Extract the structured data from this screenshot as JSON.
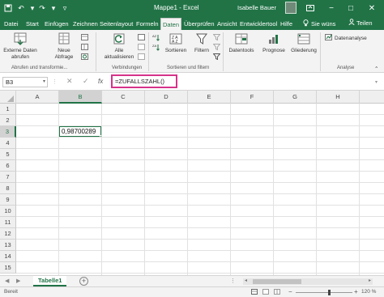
{
  "titlebar": {
    "title": "Mappe1  -  Excel",
    "user": "Isabelle Bauer",
    "minimize": "−",
    "maximize": "□",
    "close": "✕"
  },
  "tabs": [
    "Datei",
    "Start",
    "Einfügen",
    "Zeichnen",
    "Seitenlayout",
    "Formeln",
    "Daten",
    "Überprüfen",
    "Ansicht",
    "Entwicklertool",
    "Hilfe"
  ],
  "active_tab": "Daten",
  "tellme": "Sie wüns",
  "share": "Teilen",
  "ribbon": {
    "external_data": [
      "Externe Daten",
      "abrufen"
    ],
    "new_query": [
      "Neue",
      "Abfrage"
    ],
    "group1_label": "Abrufen und transformie...",
    "refresh_all": [
      "Alle",
      "aktualisieren"
    ],
    "group2_label": "Verbindungen",
    "sort": "Sortieren",
    "filter": "Filtern",
    "group3_label": "Sortieren und filtern",
    "datatools": "Datentools",
    "forecast": "Prognose",
    "outline": "Gliederung",
    "data_analysis": "Datenanalyse",
    "group4_label": "Analyse"
  },
  "formula_bar": {
    "name_box": "B3",
    "cancel": "✕",
    "enter": "✓",
    "fx": "fx",
    "formula": "=ZUFALLSZAHL()"
  },
  "columns": [
    "A",
    "B",
    "C",
    "D",
    "E",
    "F",
    "G",
    "H"
  ],
  "selected_column": "B",
  "rows": [
    "1",
    "2",
    "3",
    "4",
    "5",
    "6",
    "7",
    "8",
    "9",
    "10",
    "11",
    "12",
    "13",
    "14",
    "15"
  ],
  "selected_row": "3",
  "active_cell": {
    "ref": "B3",
    "value": "0,98700289"
  },
  "sheet_tab": "Tabelle1",
  "status": "Bereit",
  "zoom": "120 %",
  "colors": {
    "excel_green": "#217346",
    "formula_highlight": "#d6338a"
  }
}
